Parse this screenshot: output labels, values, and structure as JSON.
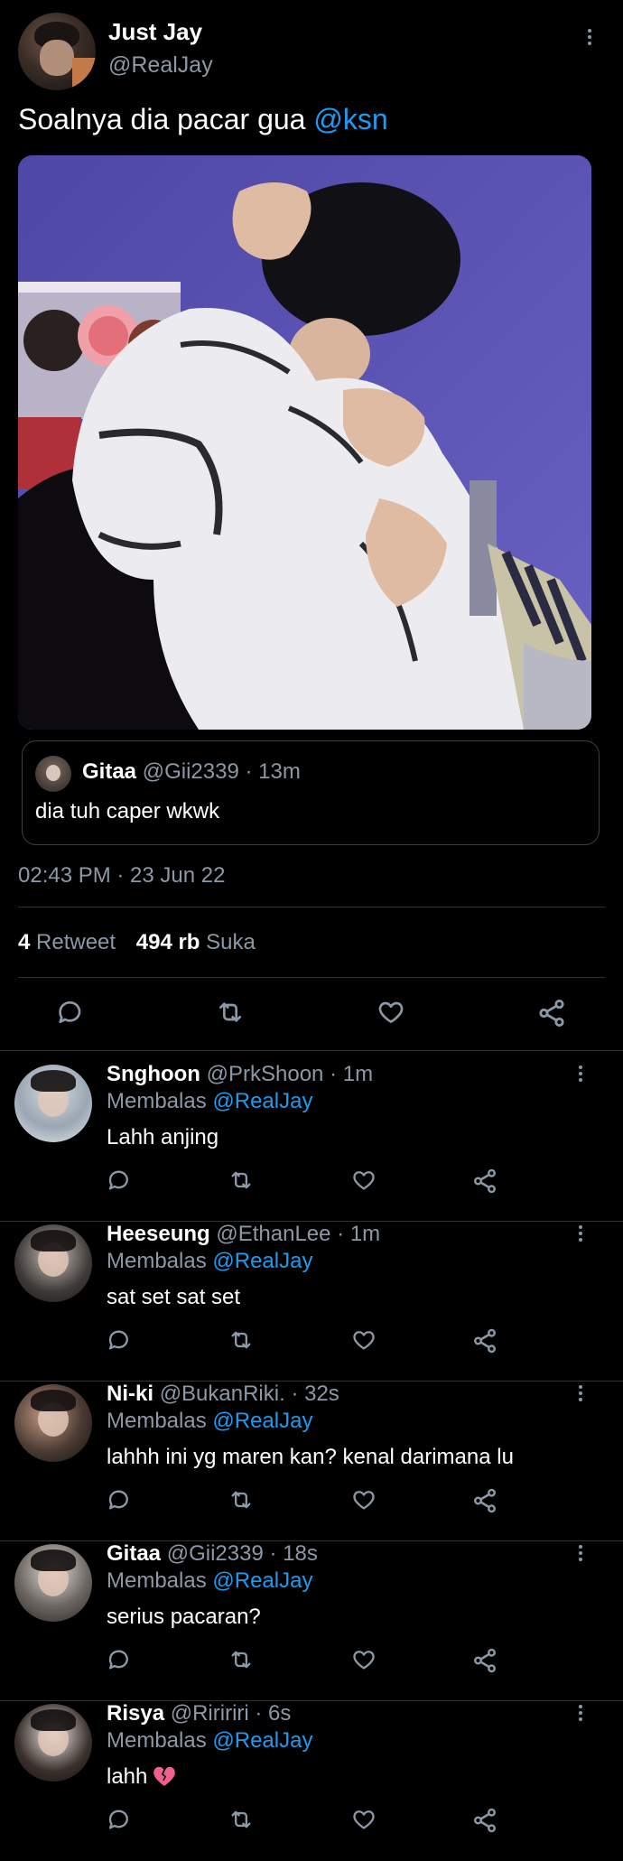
{
  "tweet": {
    "author_name": "Just Jay",
    "author_handle": "@RealJay",
    "text": "Soalnya dia pacar gua",
    "mention": "@ksn",
    "quote": {
      "name": "Gitaa",
      "handle": "@Gii2339",
      "time": "· 13m",
      "text": "dia tuh caper wkwk"
    },
    "timestamp": "02:43 PM · 23 Jun 22",
    "stats": {
      "retweets_count": "4",
      "retweets_label": "Retweet",
      "likes_count": "494 rb",
      "likes_label": "Suka"
    }
  },
  "replies": [
    {
      "name": "Snghoon",
      "handle": "@PrkShoon",
      "time": "· 1m",
      "replying_label": "Membalas",
      "replying_to": "@RealJay",
      "text": "Lahh anjing"
    },
    {
      "name": "Heeseung",
      "handle": "@EthanLee",
      "time": "· 1m",
      "replying_label": "Membalas",
      "replying_to": "@RealJay",
      "text": "sat set sat set"
    },
    {
      "name": "Ni-ki",
      "handle": "@BukanRiki.",
      "time": "· 32s",
      "replying_label": "Membalas",
      "replying_to": "@RealJay",
      "text": "lahhh ini yg maren kan? kenal darimana lu"
    },
    {
      "name": "Gitaa",
      "handle": "@Gii2339",
      "time": "· 18s",
      "replying_label": "Membalas",
      "replying_to": "@RealJay",
      "text": "serius pacaran?"
    },
    {
      "name": "Risya",
      "handle": "@Riririri",
      "time": "· 6s",
      "replying_label": "Membalas",
      "replying_to": "@RealJay",
      "text": "lahh"
    }
  ],
  "icons": [
    "reply-icon",
    "retweet-icon",
    "like-icon",
    "share-icon",
    "more-icon",
    "broken-heart-emoji"
  ],
  "colors": {
    "background": "#000000",
    "link": "#1d9bf0",
    "muted": "#8b98a5"
  }
}
